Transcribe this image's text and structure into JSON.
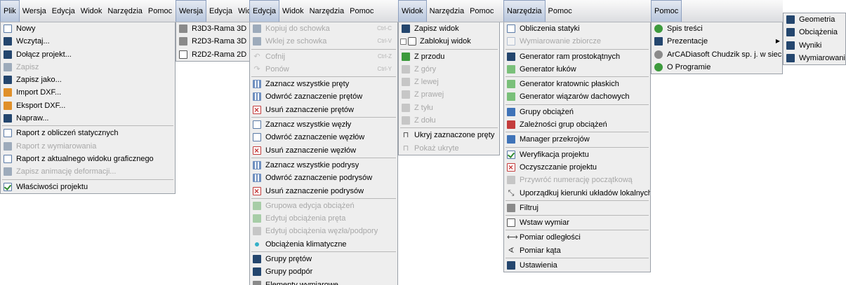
{
  "panels": [
    {
      "id": "plik",
      "menubar": [
        {
          "label": "Plik",
          "active": true
        },
        {
          "label": "Wersja"
        },
        {
          "label": "Edycja"
        },
        {
          "label": "Widok"
        },
        {
          "label": "Narzędzia"
        },
        {
          "label": "Pomoc"
        }
      ],
      "items": [
        {
          "label": "Nowy",
          "icon": "new-file-icon",
          "ic": "doc"
        },
        {
          "label": "Wczytaj...",
          "icon": "open-folder-icon",
          "ic": "navy"
        },
        {
          "label": "Dołącz projekt...",
          "icon": "attach-project-icon",
          "ic": "navy"
        },
        {
          "label": "Zapisz",
          "icon": "save-icon",
          "ic": "navy",
          "disabled": true
        },
        {
          "label": "Zapisz jako...",
          "icon": "save-as-icon",
          "ic": "navy"
        },
        {
          "label": "Import DXF...",
          "icon": "import-dxf-icon",
          "ic": "orange"
        },
        {
          "label": "Eksport DXF...",
          "icon": "export-dxf-icon",
          "ic": "orange"
        },
        {
          "label": "Napraw...",
          "icon": "repair-icon",
          "ic": "navy"
        },
        {
          "sep": true
        },
        {
          "label": "Raport z obliczeń statycznych",
          "icon": "report-icon",
          "ic": "doc"
        },
        {
          "label": "Raport z wymiarowania",
          "icon": "report-icon",
          "ic": "navy",
          "disabled": true
        },
        {
          "label": "Raport z aktualnego widoku graficznego",
          "icon": "report-view-icon",
          "ic": "doc"
        },
        {
          "label": "Zapisz animację deformacji...",
          "icon": "animation-icon",
          "ic": "navy",
          "disabled": true
        },
        {
          "sep": true
        },
        {
          "label": "Właściwości projektu",
          "icon": "project-properties-icon",
          "ic": "check"
        }
      ]
    },
    {
      "id": "wersja",
      "menubar": [
        {
          "label": "Wersja",
          "active": true
        },
        {
          "label": "Edycja"
        },
        {
          "label": "Widok"
        }
      ],
      "items": [
        {
          "label": "R3D3-Rama 3D",
          "icon": "frame-3d-icon",
          "ic": "gray"
        },
        {
          "label": "R2D3-Rama 3D",
          "icon": "frame-3d-icon",
          "ic": "gray"
        },
        {
          "label": "R2D2-Rama 2D",
          "icon": "frame-2d-icon",
          "ic": "frame"
        }
      ]
    },
    {
      "id": "edycja",
      "menubar": [
        {
          "label": "Edycja",
          "active": true
        },
        {
          "label": "Widok"
        },
        {
          "label": "Narzędzia"
        },
        {
          "label": "Pomoc"
        }
      ],
      "items": [
        {
          "label": "Kopiuj do schowka",
          "icon": "copy-icon",
          "ic": "navy",
          "disabled": true,
          "shortcut": "Ctrl-C"
        },
        {
          "label": "Wklej ze schowka",
          "icon": "paste-icon",
          "ic": "navy",
          "disabled": true,
          "shortcut": "Ctrl-V"
        },
        {
          "sep": true
        },
        {
          "label": "Cofnij",
          "icon": "undo-icon",
          "ic": "arrowsym",
          "glyph": "↶",
          "disabled": true,
          "shortcut": "Ctrl-Z"
        },
        {
          "label": "Ponów",
          "icon": "redo-icon",
          "ic": "arrowsym",
          "glyph": "↷",
          "disabled": true,
          "shortcut": "Ctrl-Y"
        },
        {
          "sep": true
        },
        {
          "label": "Zaznacz wszystkie pręty",
          "icon": "select-bars-icon",
          "ic": "grid"
        },
        {
          "label": "Odwróć zaznaczenie prętów",
          "icon": "invert-bars-icon",
          "ic": "grid"
        },
        {
          "label": "Usuń zaznaczenie prętów",
          "icon": "deselect-bars-icon",
          "ic": "cross"
        },
        {
          "sep": true
        },
        {
          "label": "Zaznacz wszystkie węzły",
          "icon": "select-nodes-icon",
          "ic": "doc"
        },
        {
          "label": "Odwróć zaznaczenie węzłów",
          "icon": "invert-nodes-icon",
          "ic": "doc"
        },
        {
          "label": "Usuń zaznaczenie węzłów",
          "icon": "deselect-nodes-icon",
          "ic": "cross"
        },
        {
          "sep": true
        },
        {
          "label": "Zaznacz wszystkie podrysy",
          "icon": "select-sublayers-icon",
          "ic": "grid"
        },
        {
          "label": "Odwróć zaznaczenie podrysów",
          "icon": "invert-sublayers-icon",
          "ic": "grid"
        },
        {
          "label": "Usuń zaznaczenie podrysów",
          "icon": "deselect-sublayers-icon",
          "ic": "cross"
        },
        {
          "sep": true
        },
        {
          "label": "Grupowa edycja obciążeń",
          "icon": "group-load-edit-icon",
          "ic": "green",
          "disabled": true
        },
        {
          "label": "Edytuj obciążenia pręta",
          "icon": "bar-load-edit-icon",
          "ic": "green",
          "disabled": true
        },
        {
          "label": "Edytuj obciążenia węzła/podpory",
          "icon": "node-load-edit-icon",
          "ic": "gray",
          "disabled": true
        },
        {
          "label": "Obciążenia klimatyczne",
          "icon": "climate-load-icon",
          "ic": "dot"
        },
        {
          "sep": true
        },
        {
          "label": "Grupy prętów",
          "icon": "bar-groups-icon",
          "ic": "navy"
        },
        {
          "label": "Grupy podpór",
          "icon": "support-groups-icon",
          "ic": "navy"
        },
        {
          "label": "Elementy wymiarowe",
          "icon": "dimension-elements-icon",
          "ic": "gray"
        }
      ]
    },
    {
      "id": "widok",
      "menubar": [
        {
          "label": "Widok",
          "active": true
        },
        {
          "label": "Narzędzia"
        },
        {
          "label": "Pomoc"
        }
      ],
      "items": [
        {
          "label": "Zapisz widok",
          "icon": "save-view-icon",
          "ic": "navy"
        },
        {
          "label": "Zablokuj widok",
          "icon": "lock-view-icon",
          "ic": "lock",
          "checkbox": true
        },
        {
          "sep": true
        },
        {
          "label": "Z przodu",
          "icon": "view-front-icon",
          "ic": "green"
        },
        {
          "label": "Z góry",
          "icon": "view-top-icon",
          "ic": "gray",
          "disabled": true
        },
        {
          "label": "Z lewej",
          "icon": "view-left-icon",
          "ic": "gray",
          "disabled": true
        },
        {
          "label": "Z prawej",
          "icon": "view-right-icon",
          "ic": "gray",
          "disabled": true
        },
        {
          "label": "Z tyłu",
          "icon": "view-back-icon",
          "ic": "gray",
          "disabled": true
        },
        {
          "label": "Z dołu",
          "icon": "view-bottom-icon",
          "ic": "gray",
          "disabled": true
        },
        {
          "sep": true
        },
        {
          "label": "Ukryj zaznaczone pręty",
          "icon": "hide-bars-icon",
          "ic": "sym",
          "glyph": "⊓"
        },
        {
          "label": "Pokaż ukryte",
          "icon": "show-hidden-icon",
          "ic": "sym",
          "glyph": "⊓",
          "disabled": true
        }
      ]
    },
    {
      "id": "narzedzia",
      "menubar": [
        {
          "label": "Narzędzia",
          "active": true
        },
        {
          "label": "Pomoc"
        }
      ],
      "items": [
        {
          "label": "Obliczenia statyki",
          "icon": "statics-calc-icon",
          "ic": "doc"
        },
        {
          "label": "Wymiarowanie zbiorcze",
          "icon": "bulk-dimensioning-icon",
          "ic": "doc",
          "disabled": true
        },
        {
          "sep": true
        },
        {
          "label": "Generator ram prostokątnych",
          "icon": "rect-frame-generator-icon",
          "ic": "navy"
        },
        {
          "label": "Generator łuków",
          "icon": "arch-generator-icon",
          "ic": "lgreen"
        },
        {
          "sep": true
        },
        {
          "label": "Generator kratownic płaskich",
          "icon": "truss-generator-icon",
          "ic": "lgreen"
        },
        {
          "label": "Generator wiązarów dachowych",
          "icon": "roof-truss-generator-icon",
          "ic": "lgreen"
        },
        {
          "sep": true
        },
        {
          "label": "Grupy obciążeń",
          "icon": "load-groups-icon",
          "ic": "blue"
        },
        {
          "label": "Zależności grup obciążeń",
          "icon": "load-group-dependencies-icon",
          "ic": "red"
        },
        {
          "sep": true
        },
        {
          "label": "Manager przekrojów",
          "icon": "section-manager-icon",
          "ic": "blue"
        },
        {
          "sep": true
        },
        {
          "label": "Weryfikacja projektu",
          "icon": "verify-project-icon",
          "ic": "check"
        },
        {
          "label": "Oczyszczanie projektu",
          "icon": "clean-project-icon",
          "ic": "cross"
        },
        {
          "label": "Przywróć numerację początkową",
          "icon": "restore-numbering-icon",
          "ic": "gray",
          "disabled": true
        },
        {
          "label": "Uporządkuj kierunki układów lokalnych",
          "icon": "local-axes-icon",
          "ic": "sym",
          "glyph": "⤡"
        },
        {
          "sep": true
        },
        {
          "label": "Filtruj",
          "icon": "filter-icon",
          "ic": "gray"
        },
        {
          "sep": true
        },
        {
          "label": "Wstaw wymiar",
          "icon": "insert-dimension-icon",
          "ic": "frame"
        },
        {
          "sep": true
        },
        {
          "label": "Pomiar odległości",
          "icon": "measure-distance-icon",
          "ic": "sym",
          "glyph": "⟷"
        },
        {
          "label": "Pomiar kąta",
          "icon": "measure-angle-icon",
          "ic": "sym",
          "glyph": "∢"
        },
        {
          "sep": true
        },
        {
          "label": "Ustawienia",
          "icon": "settings-icon",
          "ic": "navy"
        }
      ]
    },
    {
      "id": "pomoc",
      "menubar": [
        {
          "label": "Pomoc",
          "active": true
        }
      ],
      "items": [
        {
          "label": "Spis treści",
          "icon": "help-contents-icon",
          "ic": "green",
          "round": true
        },
        {
          "label": "Prezentacje",
          "icon": "presentations-icon",
          "ic": "navy",
          "submenu": true
        },
        {
          "label": "ArCADiasoft Chudzik sp. j. w sieci",
          "icon": "web-icon",
          "ic": "gray",
          "round": true
        },
        {
          "label": "O Programie",
          "icon": "about-icon",
          "ic": "green",
          "round": true
        }
      ]
    },
    {
      "id": "prezentacje",
      "menubar": [],
      "items": [
        {
          "label": "Geometria",
          "icon": "film-icon",
          "ic": "navy"
        },
        {
          "label": "Obciążenia",
          "icon": "film-icon",
          "ic": "navy"
        },
        {
          "label": "Wyniki",
          "icon": "film-icon",
          "ic": "navy"
        },
        {
          "label": "Wymiarowanie",
          "icon": "film-icon",
          "ic": "navy"
        }
      ]
    }
  ]
}
